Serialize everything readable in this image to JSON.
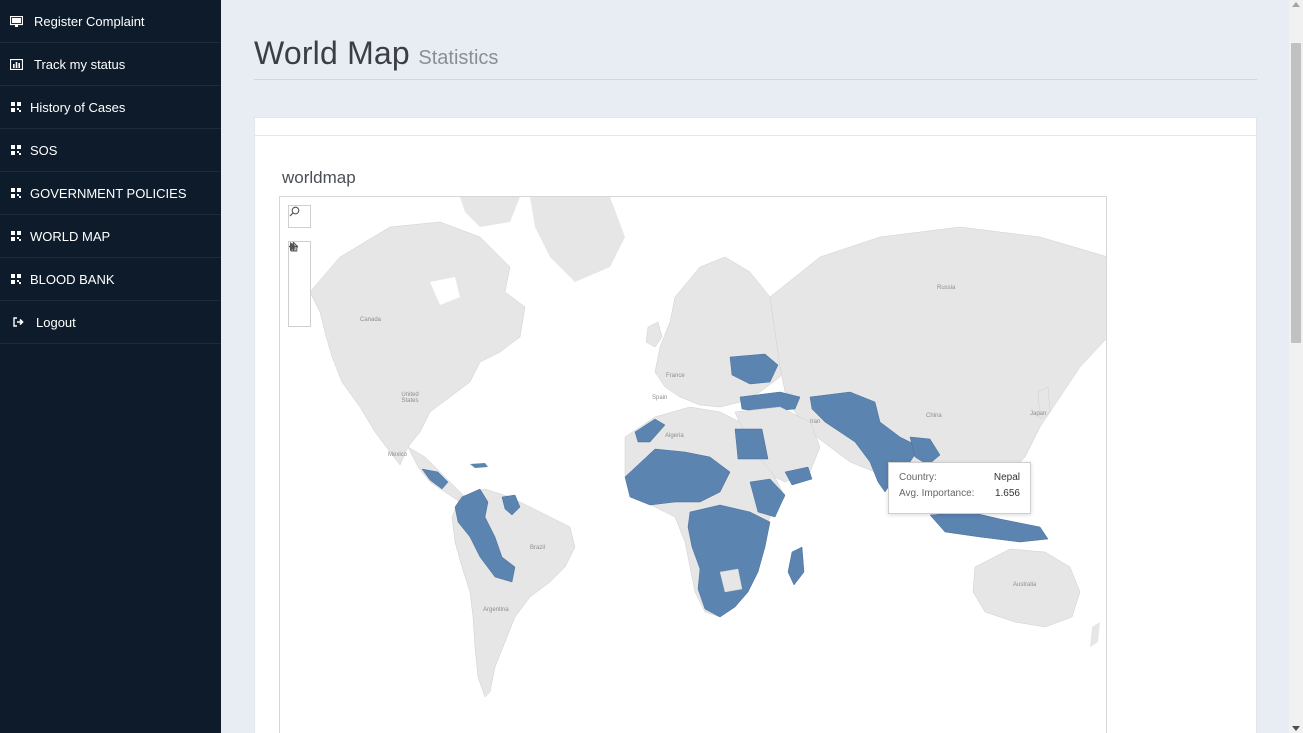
{
  "sidebar": {
    "items": [
      {
        "label": "Register Complaint",
        "icon": "monitor-icon"
      },
      {
        "label": "Track my status",
        "icon": "bar-chart-icon"
      },
      {
        "label": "History of Cases",
        "icon": "qrcode-icon"
      },
      {
        "label": "SOS",
        "icon": "qrcode-icon"
      },
      {
        "label": "GOVERNMENT POLICIES",
        "icon": "qrcode-icon"
      },
      {
        "label": "WORLD MAP",
        "icon": "qrcode-icon"
      },
      {
        "label": "BLOOD BANK",
        "icon": "qrcode-icon"
      },
      {
        "label": "Logout",
        "icon": "sign-out-icon"
      }
    ]
  },
  "header": {
    "title": "World Map",
    "subtitle": "Statistics"
  },
  "viz": {
    "title": "worldmap"
  },
  "map": {
    "highlight_color": "#5b84b1",
    "base_color": "#e6e6e6",
    "labels": {
      "canada": "Canada",
      "usa": "United States",
      "mexico": "Mexico",
      "brazil": "Brazil",
      "argentina": "Argentina",
      "russia": "Russia",
      "china": "China",
      "japan": "Japan",
      "iran": "Iran",
      "france": "France",
      "spain": "Spain",
      "algeria": "Algeria",
      "australia": "Australia"
    },
    "tooltip": {
      "country_label": "Country:",
      "country_value": "Nepal",
      "importance_label": "Avg. Importance:",
      "importance_value": "1.656"
    }
  },
  "colors": {
    "sidebar_bg": "#0d1b2a",
    "page_bg": "#e8edf4"
  }
}
